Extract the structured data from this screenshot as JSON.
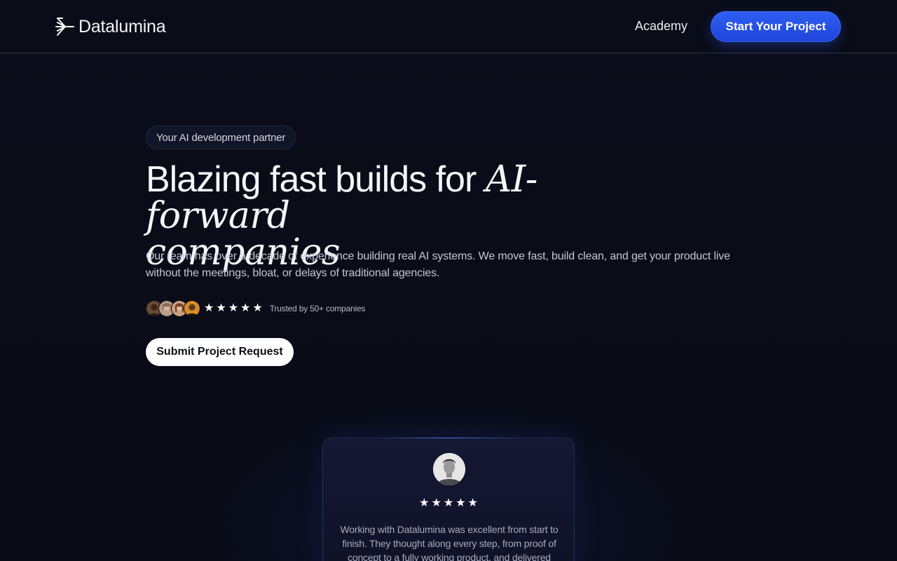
{
  "nav": {
    "logo_text": "Datalumina",
    "logo_icon": "sunburst-logo-icon",
    "academy_label": "Academy",
    "cta_label": "Start Your Project"
  },
  "hero": {
    "badge": "Your AI development partner",
    "headline_plain": "Blazing fast builds for ",
    "headline_accent_1": "AI-forward",
    "headline_accent_2": "companies",
    "subcopy": "Our team has over a decade of experience building real AI systems. We move fast, build clean, and get your product live without the meetings, bloat, or delays of traditional agencies.",
    "rating_stars": 5,
    "trusted_text": "Trusted by 50+ companies",
    "submit_label": "Submit Project Request"
  },
  "testimonial": {
    "rating_stars": 5,
    "quote": "Working with Datalumina was excellent from start to finish. They thought along every step, from proof of concept to a fully working product, and delivered results"
  },
  "colors": {
    "background": "#090b15",
    "accent_blue": "#2a55ee",
    "text_primary": "#f5f6fa",
    "text_muted": "#c5c8d4"
  }
}
